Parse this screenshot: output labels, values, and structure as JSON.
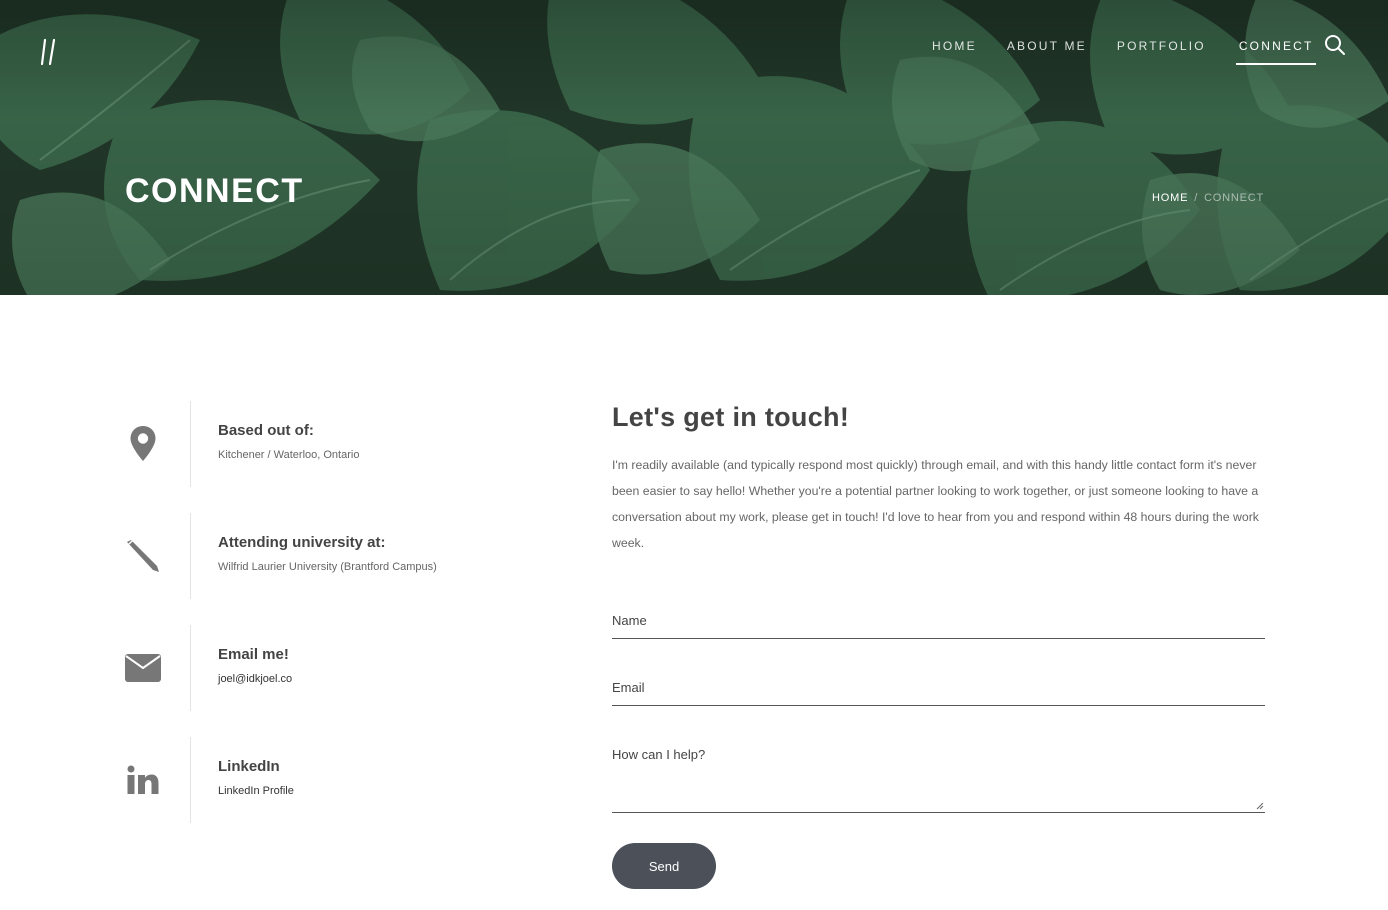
{
  "header": {
    "nav": [
      {
        "label": "HOME",
        "active": false
      },
      {
        "label": "ABOUT ME",
        "active": false
      },
      {
        "label": "PORTFOLIO",
        "active": false
      },
      {
        "label": "CONNECT",
        "active": true
      }
    ],
    "page_title": "CONNECT",
    "breadcrumb": {
      "home": "HOME",
      "separator": "/",
      "current": "CONNECT"
    }
  },
  "info": [
    {
      "icon": "location-pin-icon",
      "heading": "Based out of:",
      "text": "Kitchener / Waterloo, Ontario"
    },
    {
      "icon": "pencil-icon",
      "heading": "Attending university at:",
      "text": "Wilfrid Laurier University (Brantford Campus)"
    },
    {
      "icon": "envelope-icon",
      "heading": "Email me!",
      "text": "joel@idkjoel.co"
    },
    {
      "icon": "linkedin-icon",
      "heading": "LinkedIn",
      "text": "LinkedIn Profile"
    }
  ],
  "contact": {
    "title": "Let's get in touch!",
    "intro": "I'm readily available (and typically respond most quickly) through email, and with this handy little contact form it's never been easier to say hello! Whether you're a potential partner looking to work together, or just someone looking to have a conversation about my work, please get in touch! I'd love to hear from you and respond within 48 hours during the work week.",
    "name_label": "Name",
    "email_label": "Email",
    "message_label": "How can I help?",
    "send_label": "Send"
  },
  "colors": {
    "accent": "#4b5059",
    "hero_green": "#2b4a36",
    "icon_gray": "#777777"
  }
}
